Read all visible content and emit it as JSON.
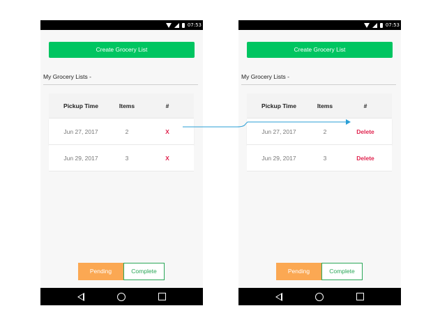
{
  "status": {
    "time": "07:53"
  },
  "screens": [
    {
      "create_button": "Create Grocery List",
      "heading": "My Grocery Lists -",
      "columns": [
        "Pickup Time",
        "Items",
        "#"
      ],
      "rows": [
        {
          "pickup": "Jun 27, 2017",
          "items": "2",
          "action": "X"
        },
        {
          "pickup": "Jun 29, 2017",
          "items": "3",
          "action": "X"
        }
      ],
      "toggle": {
        "pending": "Pending",
        "complete": "Complete"
      }
    },
    {
      "create_button": "Create Grocery List",
      "heading": "My Grocery Lists -",
      "columns": [
        "Pickup Time",
        "Items",
        "#"
      ],
      "rows": [
        {
          "pickup": "Jun 27, 2017",
          "items": "2",
          "action": "Delete"
        },
        {
          "pickup": "Jun 29, 2017",
          "items": "3",
          "action": "Delete"
        }
      ],
      "toggle": {
        "pending": "Pending",
        "complete": "Complete"
      }
    }
  ],
  "colors": {
    "primary_green": "#00c561",
    "pending_orange": "#fba853",
    "complete_green": "#2aa757",
    "delete_red": "#e0234e",
    "arrow_blue": "#2a9fd6"
  },
  "icons": [
    "wifi-icon",
    "signal-icon",
    "battery-icon",
    "back-icon",
    "home-icon",
    "recents-icon"
  ]
}
